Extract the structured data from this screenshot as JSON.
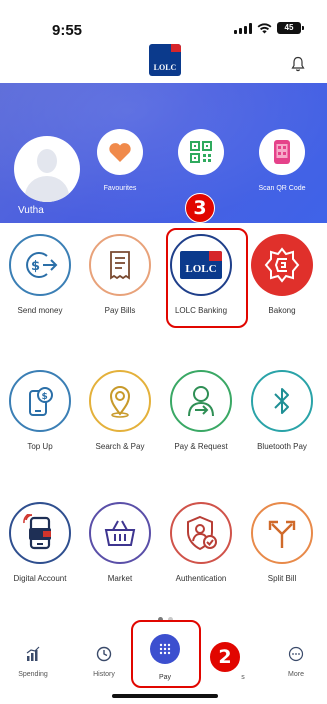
{
  "status": {
    "time": "9:55",
    "battery": "45"
  },
  "header": {
    "logo_text": "LOLC"
  },
  "profile": {
    "name": "Vutha"
  },
  "quick_actions": [
    {
      "label": "Favourites",
      "icon": "heart-icon"
    },
    {
      "label": "",
      "icon": "qr-code-icon"
    },
    {
      "label": "Scan QR Code",
      "icon": "scan-qr-icon"
    }
  ],
  "services": [
    {
      "label": "Send money",
      "icon": "send-money-icon",
      "color": "#3b7fb5"
    },
    {
      "label": "Pay Bills",
      "icon": "bill-icon",
      "color": "#e8a27a"
    },
    {
      "label": "LOLC Banking",
      "icon": "lolc-logo-icon",
      "color": "#1f3f8a"
    },
    {
      "label": "Bakong",
      "icon": "bakong-icon",
      "color": "#e0302b"
    },
    {
      "label": "Top Up",
      "icon": "top-up-icon",
      "color": "#3b7fb5"
    },
    {
      "label": "Search & Pay",
      "icon": "location-pin-icon",
      "color": "#e4b13b"
    },
    {
      "label": "Pay & Request",
      "icon": "person-arrow-icon",
      "color": "#3aa865"
    },
    {
      "label": "Bluetooth Pay",
      "icon": "bluetooth-icon",
      "color": "#2aa3a8"
    },
    {
      "label": "Digital Account",
      "icon": "wallet-phone-icon",
      "color": "#2f4f8f"
    },
    {
      "label": "Market",
      "icon": "basket-icon",
      "color": "#5a4fa8"
    },
    {
      "label": "Authentication",
      "icon": "shield-user-icon",
      "color": "#d0534a"
    },
    {
      "label": "Split Bill",
      "icon": "split-arrow-icon",
      "color": "#e88a4a"
    }
  ],
  "annotations": {
    "step_three": "3",
    "step_two": "2"
  },
  "nav": [
    {
      "label": "Spending",
      "icon": "chart-icon"
    },
    {
      "label": "History",
      "icon": "clock-icon"
    },
    {
      "label": "Pay",
      "icon": "grid-icon"
    },
    {
      "label": "s",
      "icon": ""
    },
    {
      "label": "More",
      "icon": "more-icon"
    }
  ],
  "colors": {
    "accent": "#3c4fcf",
    "annotation": "#e10600",
    "band": "#4a5fe0"
  }
}
